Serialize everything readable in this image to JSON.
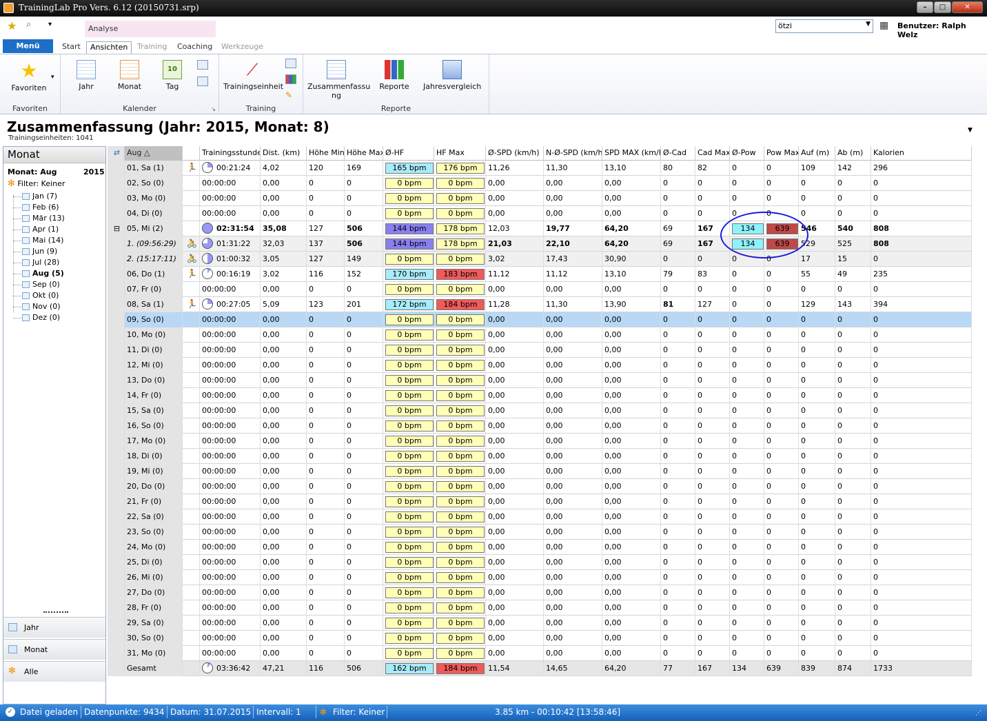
{
  "window": {
    "title": "TrainingLab Pro Vers. 6.12 (20150731.srp)"
  },
  "ribbon": {
    "context_tab": "Analyse",
    "menu_label": "Menü",
    "tabs": [
      "Start",
      "Ansichten",
      "Training",
      "Coaching",
      "Werkzeuge"
    ],
    "user_select": "ötzi",
    "user_label": "Benutzer: Ralph Welz",
    "groups": {
      "favoriten": "Favoriten",
      "kalender": "Kalender",
      "training": "Training",
      "reporte": "Reporte"
    },
    "buttons": {
      "favoriten": "Favoriten",
      "jahr": "Jahr",
      "monat": "Monat",
      "tag": "Tag",
      "tag_icon": "10",
      "trainingseinheit": "Trainingseinheit",
      "zusammenfassung": "Zusammenfassu ng",
      "reporte": "Reporte",
      "jahresvergleich": "Jahresvergleich"
    }
  },
  "page": {
    "title": "Zusammenfassung (Jahr: 2015, Monat: 8)",
    "subtitle": "Trainingseinheiten: 1041"
  },
  "left_panel": {
    "header": "Monat",
    "month_label": "Monat: Aug",
    "year": "2015",
    "filter": "Filter: Keiner",
    "months": [
      {
        "label": "Jan (7)"
      },
      {
        "label": "Feb (6)"
      },
      {
        "label": "Mär (13)"
      },
      {
        "label": "Apr (1)"
      },
      {
        "label": "Mai (14)"
      },
      {
        "label": "Jun (9)"
      },
      {
        "label": "Jul (28)"
      },
      {
        "label": "Aug (5)",
        "active": true
      },
      {
        "label": "Sep (0)"
      },
      {
        "label": "Okt (0)"
      },
      {
        "label": "Nov (0)"
      },
      {
        "label": "Dez (0)"
      }
    ],
    "nav": [
      "Jahr",
      "Monat",
      "Alle"
    ]
  },
  "table": {
    "columns": [
      "Aug",
      "Trainingsstunden",
      "Dist. (km)",
      "Höhe Min",
      "Höhe Max",
      "Ø-HF",
      "HF Max",
      "Ø-SPD (km/h)",
      "N-Ø-SPD (km/h)",
      "SPD MAX (km/h)",
      "Ø-Cad",
      "Cad Max",
      "Ø-Pow",
      "Pow Max",
      "Auf (m)",
      "Ab (m)",
      "Kalorien"
    ],
    "sort_indicator": "△",
    "rows": [
      [
        "01, Sa (1)",
        "00:21:24",
        "4,02",
        "120",
        "169",
        "165 bpm",
        "176 bpm",
        "11,26",
        "11,30",
        "13,10",
        "80",
        "82",
        "0",
        "0",
        "109",
        "142",
        "296"
      ],
      [
        "02, So (0)",
        "00:00:00",
        "0,00",
        "0",
        "0",
        "0 bpm",
        "0 bpm",
        "0,00",
        "0,00",
        "0,00",
        "0",
        "0",
        "0",
        "0",
        "0",
        "0",
        "0"
      ],
      [
        "03, Mo (0)",
        "00:00:00",
        "0,00",
        "0",
        "0",
        "0 bpm",
        "0 bpm",
        "0,00",
        "0,00",
        "0,00",
        "0",
        "0",
        "0",
        "0",
        "0",
        "0",
        "0"
      ],
      [
        "04, Di (0)",
        "00:00:00",
        "0,00",
        "0",
        "0",
        "0 bpm",
        "0 bpm",
        "0,00",
        "0,00",
        "0,00",
        "0",
        "0",
        "0",
        "0",
        "0",
        "0",
        "0"
      ],
      [
        "05, Mi (2)",
        "02:31:54",
        "35,08",
        "127",
        "506",
        "144 bpm",
        "178 bpm",
        "12,03",
        "19,77",
        "64,20",
        "69",
        "167",
        "134",
        "639",
        "546",
        "540",
        "808"
      ],
      [
        "1. (09:56:29)",
        "01:31:22",
        "32,03",
        "137",
        "506",
        "144 bpm",
        "178 bpm",
        "21,03",
        "22,10",
        "64,20",
        "69",
        "167",
        "134",
        "639",
        "529",
        "525",
        "808"
      ],
      [
        "2. (15:17:11)",
        "01:00:32",
        "3,05",
        "127",
        "149",
        "0 bpm",
        "0 bpm",
        "3,02",
        "17,43",
        "30,90",
        "0",
        "0",
        "0",
        "0",
        "17",
        "15",
        "0"
      ],
      [
        "06, Do (1)",
        "00:16:19",
        "3,02",
        "116",
        "152",
        "170 bpm",
        "183 bpm",
        "11,12",
        "11,12",
        "13,10",
        "79",
        "83",
        "0",
        "0",
        "55",
        "49",
        "235"
      ],
      [
        "07, Fr (0)",
        "00:00:00",
        "0,00",
        "0",
        "0",
        "0 bpm",
        "0 bpm",
        "0,00",
        "0,00",
        "0,00",
        "0",
        "0",
        "0",
        "0",
        "0",
        "0",
        "0"
      ],
      [
        "08, Sa (1)",
        "00:27:05",
        "5,09",
        "123",
        "201",
        "172 bpm",
        "184 bpm",
        "11,28",
        "11,30",
        "13,90",
        "81",
        "127",
        "0",
        "0",
        "129",
        "143",
        "394"
      ],
      [
        "09, So (0)",
        "00:00:00",
        "0,00",
        "0",
        "0",
        "0 bpm",
        "0 bpm",
        "0,00",
        "0,00",
        "0,00",
        "0",
        "0",
        "0",
        "0",
        "0",
        "0",
        "0"
      ],
      [
        "10, Mo (0)",
        "00:00:00",
        "0,00",
        "0",
        "0",
        "0 bpm",
        "0 bpm",
        "0,00",
        "0,00",
        "0,00",
        "0",
        "0",
        "0",
        "0",
        "0",
        "0",
        "0"
      ],
      [
        "11, Di (0)",
        "00:00:00",
        "0,00",
        "0",
        "0",
        "0 bpm",
        "0 bpm",
        "0,00",
        "0,00",
        "0,00",
        "0",
        "0",
        "0",
        "0",
        "0",
        "0",
        "0"
      ],
      [
        "12, Mi (0)",
        "00:00:00",
        "0,00",
        "0",
        "0",
        "0 bpm",
        "0 bpm",
        "0,00",
        "0,00",
        "0,00",
        "0",
        "0",
        "0",
        "0",
        "0",
        "0",
        "0"
      ],
      [
        "13, Do (0)",
        "00:00:00",
        "0,00",
        "0",
        "0",
        "0 bpm",
        "0 bpm",
        "0,00",
        "0,00",
        "0,00",
        "0",
        "0",
        "0",
        "0",
        "0",
        "0",
        "0"
      ],
      [
        "14, Fr (0)",
        "00:00:00",
        "0,00",
        "0",
        "0",
        "0 bpm",
        "0 bpm",
        "0,00",
        "0,00",
        "0,00",
        "0",
        "0",
        "0",
        "0",
        "0",
        "0",
        "0"
      ],
      [
        "15, Sa (0)",
        "00:00:00",
        "0,00",
        "0",
        "0",
        "0 bpm",
        "0 bpm",
        "0,00",
        "0,00",
        "0,00",
        "0",
        "0",
        "0",
        "0",
        "0",
        "0",
        "0"
      ],
      [
        "16, So (0)",
        "00:00:00",
        "0,00",
        "0",
        "0",
        "0 bpm",
        "0 bpm",
        "0,00",
        "0,00",
        "0,00",
        "0",
        "0",
        "0",
        "0",
        "0",
        "0",
        "0"
      ],
      [
        "17, Mo (0)",
        "00:00:00",
        "0,00",
        "0",
        "0",
        "0 bpm",
        "0 bpm",
        "0,00",
        "0,00",
        "0,00",
        "0",
        "0",
        "0",
        "0",
        "0",
        "0",
        "0"
      ],
      [
        "18, Di (0)",
        "00:00:00",
        "0,00",
        "0",
        "0",
        "0 bpm",
        "0 bpm",
        "0,00",
        "0,00",
        "0,00",
        "0",
        "0",
        "0",
        "0",
        "0",
        "0",
        "0"
      ],
      [
        "19, Mi (0)",
        "00:00:00",
        "0,00",
        "0",
        "0",
        "0 bpm",
        "0 bpm",
        "0,00",
        "0,00",
        "0,00",
        "0",
        "0",
        "0",
        "0",
        "0",
        "0",
        "0"
      ],
      [
        "20, Do (0)",
        "00:00:00",
        "0,00",
        "0",
        "0",
        "0 bpm",
        "0 bpm",
        "0,00",
        "0,00",
        "0,00",
        "0",
        "0",
        "0",
        "0",
        "0",
        "0",
        "0"
      ],
      [
        "21, Fr (0)",
        "00:00:00",
        "0,00",
        "0",
        "0",
        "0 bpm",
        "0 bpm",
        "0,00",
        "0,00",
        "0,00",
        "0",
        "0",
        "0",
        "0",
        "0",
        "0",
        "0"
      ],
      [
        "22, Sa (0)",
        "00:00:00",
        "0,00",
        "0",
        "0",
        "0 bpm",
        "0 bpm",
        "0,00",
        "0,00",
        "0,00",
        "0",
        "0",
        "0",
        "0",
        "0",
        "0",
        "0"
      ],
      [
        "23, So (0)",
        "00:00:00",
        "0,00",
        "0",
        "0",
        "0 bpm",
        "0 bpm",
        "0,00",
        "0,00",
        "0,00",
        "0",
        "0",
        "0",
        "0",
        "0",
        "0",
        "0"
      ],
      [
        "24, Mo (0)",
        "00:00:00",
        "0,00",
        "0",
        "0",
        "0 bpm",
        "0 bpm",
        "0,00",
        "0,00",
        "0,00",
        "0",
        "0",
        "0",
        "0",
        "0",
        "0",
        "0"
      ],
      [
        "25, Di (0)",
        "00:00:00",
        "0,00",
        "0",
        "0",
        "0 bpm",
        "0 bpm",
        "0,00",
        "0,00",
        "0,00",
        "0",
        "0",
        "0",
        "0",
        "0",
        "0",
        "0"
      ],
      [
        "26, Mi (0)",
        "00:00:00",
        "0,00",
        "0",
        "0",
        "0 bpm",
        "0 bpm",
        "0,00",
        "0,00",
        "0,00",
        "0",
        "0",
        "0",
        "0",
        "0",
        "0",
        "0"
      ],
      [
        "27, Do (0)",
        "00:00:00",
        "0,00",
        "0",
        "0",
        "0 bpm",
        "0 bpm",
        "0,00",
        "0,00",
        "0,00",
        "0",
        "0",
        "0",
        "0",
        "0",
        "0",
        "0"
      ],
      [
        "28, Fr (0)",
        "00:00:00",
        "0,00",
        "0",
        "0",
        "0 bpm",
        "0 bpm",
        "0,00",
        "0,00",
        "0,00",
        "0",
        "0",
        "0",
        "0",
        "0",
        "0",
        "0"
      ],
      [
        "29, Sa (0)",
        "00:00:00",
        "0,00",
        "0",
        "0",
        "0 bpm",
        "0 bpm",
        "0,00",
        "0,00",
        "0,00",
        "0",
        "0",
        "0",
        "0",
        "0",
        "0",
        "0"
      ],
      [
        "30, So (0)",
        "00:00:00",
        "0,00",
        "0",
        "0",
        "0 bpm",
        "0 bpm",
        "0,00",
        "0,00",
        "0,00",
        "0",
        "0",
        "0",
        "0",
        "0",
        "0",
        "0"
      ],
      [
        "31, Mo (0)",
        "00:00:00",
        "0,00",
        "0",
        "0",
        "0 bpm",
        "0 bpm",
        "0,00",
        "0,00",
        "0,00",
        "0",
        "0",
        "0",
        "0",
        "0",
        "0",
        "0"
      ],
      [
        "Gesamt",
        "03:36:42",
        "47,21",
        "116",
        "506",
        "162 bpm",
        "184 bpm",
        "11,54",
        "14,65",
        "64,20",
        "77",
        "167",
        "134",
        "639",
        "839",
        "874",
        "1733"
      ]
    ]
  },
  "status": {
    "loaded": "Datei geladen",
    "points": "Datenpunkte: 9434",
    "date": "Datum: 31.07.2015",
    "interval": "Intervall: 1",
    "filter": "Filter: Keiner",
    "position": "3.85 km - 00:10:42 [13:58:46]"
  }
}
